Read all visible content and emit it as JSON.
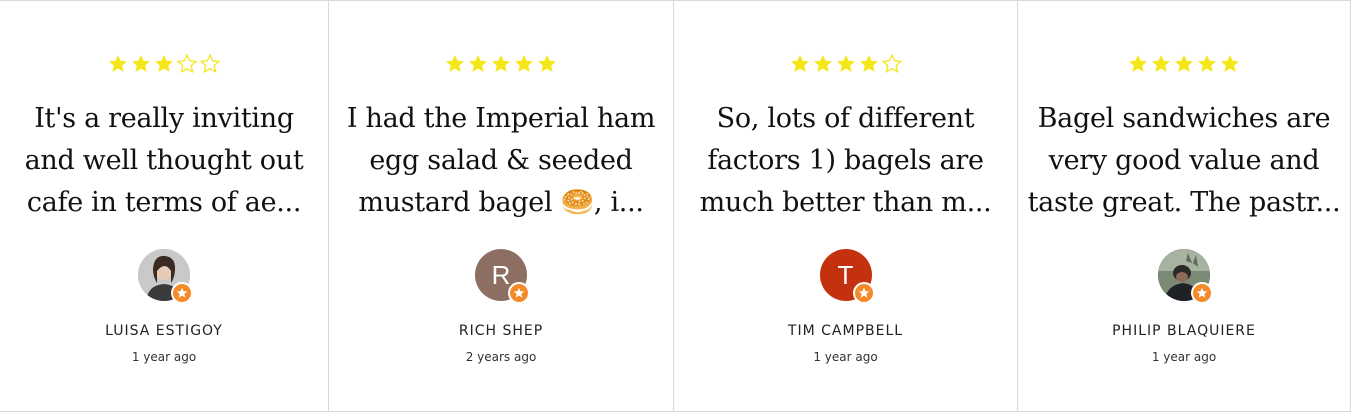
{
  "colors": {
    "star_filled": "#f5e61a",
    "star_outline": "#f5e61a",
    "badge": "#f58a2a",
    "divider": "#d9d9d9"
  },
  "reviews": [
    {
      "rating": 3,
      "text": "It's a really inviting and well thought out cafe in terms of ae...",
      "author": "LUISA ESTIGOY",
      "time": "1 year ago",
      "avatar": {
        "type": "photo",
        "initial": "",
        "color": "#b7b7b7"
      }
    },
    {
      "rating": 5,
      "text": "I had the Imperial ham egg salad & seeded mustard bagel 🥯, i...",
      "author": "RICH SHEP",
      "time": "2 years ago",
      "avatar": {
        "type": "initial",
        "initial": "R",
        "color": "#8d6e63"
      }
    },
    {
      "rating": 4,
      "text": "So, lots of different factors 1) bagels are much better than m...",
      "author": "TIM CAMPBELL",
      "time": "1 year ago",
      "avatar": {
        "type": "initial",
        "initial": "T",
        "color": "#c4310f"
      }
    },
    {
      "rating": 5,
      "text": "Bagel sandwiches are very good value and taste great. The pastr...",
      "author": "PHILIP BLAQUIERE",
      "time": "1 year ago",
      "avatar": {
        "type": "photo",
        "initial": "",
        "color": "#4a4f55"
      }
    }
  ]
}
